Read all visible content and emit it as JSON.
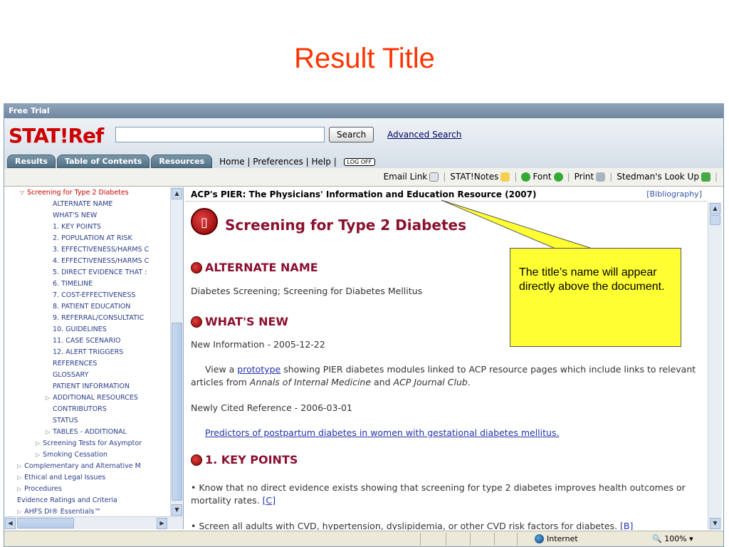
{
  "slide": {
    "title": "Result Title"
  },
  "app": {
    "topbar_text": "Free Trial",
    "logo": "STAT!Ref",
    "search": {
      "value": "",
      "button": "Search",
      "advanced": "Advanced Search"
    },
    "tabs": [
      "Results",
      "Table of Contents",
      "Resources"
    ],
    "toplinks": {
      "home": "Home",
      "preferences": "Preferences",
      "help": "Help",
      "logoff": "LOG OFF"
    },
    "toolbar": {
      "email": "Email Link",
      "notes": "STAT!Notes",
      "font": "Font",
      "print": "Print",
      "stedman": "Stedman's Look Up"
    }
  },
  "sidebar": {
    "items": [
      {
        "label": "Screening for Type 2 Diabetes",
        "arrow": "▽",
        "red": true
      },
      {
        "label": "ALTERNATE NAME"
      },
      {
        "label": "WHAT'S NEW"
      },
      {
        "label": "1. KEY POINTS"
      },
      {
        "label": "2. POPULATION AT RISK"
      },
      {
        "label": "3. EFFECTIVENESS/HARMS C"
      },
      {
        "label": "4. EFFECTIVENESS/HARMS C"
      },
      {
        "label": "5. DIRECT EVIDENCE THAT :"
      },
      {
        "label": "6. TIMELINE"
      },
      {
        "label": "7. COST-EFFECTIVENESS"
      },
      {
        "label": "8. PATIENT EDUCATION"
      },
      {
        "label": "9. REFERRAL/CONSULTATIC"
      },
      {
        "label": "10. GUIDELINES"
      },
      {
        "label": "11. CASE SCENARIO"
      },
      {
        "label": "12. ALERT TRIGGERS"
      },
      {
        "label": "REFERENCES"
      },
      {
        "label": "GLOSSARY"
      },
      {
        "label": "PATIENT INFORMATION"
      },
      {
        "label": "ADDITIONAL RESOURCES",
        "arrow": "▷"
      },
      {
        "label": "CONTRIBUTORS"
      },
      {
        "label": "STATUS"
      },
      {
        "label": "TABLES - ADDITIONAL",
        "arrow": "▷"
      },
      {
        "label": "Screening Tests for Asymptor",
        "arrow": "▷"
      },
      {
        "label": "Smoking Cessation",
        "arrow": "▷"
      },
      {
        "label": "Complementary and Alternative M",
        "arrow": "▷"
      },
      {
        "label": "Ethical and Legal Issues",
        "arrow": "▷"
      },
      {
        "label": "Procedures",
        "arrow": "▷"
      },
      {
        "label": "Evidence Ratings and Criteria"
      },
      {
        "label": "AHFS DI® Essentials™",
        "arrow": "▷"
      }
    ]
  },
  "document": {
    "header": "ACP's PIER: The Physicians' Information and Education Resource (2007)",
    "bibliography": "[Bibliography]",
    "title": "Screening for Type 2 Diabetes",
    "sections": {
      "alt_name_head": "ALTERNATE NAME",
      "alt_name_text": "Diabetes Screening; Screening for Diabetes Mellitus",
      "whats_new_head": "WHAT'S NEW",
      "new_info": "New Information - 2005-12-22",
      "view_a": "View a",
      "prototype": "prototype",
      "view_rest": "showing PIER diabetes modules linked to ACP resource pages which include links to relevant articles from",
      "annals": "Annals of Internal Medicine",
      "and": "and",
      "acp_journal": "ACP Journal Club",
      "period": ".",
      "newly_cited": "Newly Cited Reference - 2006-03-01",
      "predictors": "Predictors of postpartum diabetes in women with gestational diabetes mellitus.",
      "key_points_head": "1. KEY POINTS",
      "kp1": "• Know that no direct evidence exists showing that screening for type 2 diabetes improves health outcomes or mortality rates.",
      "kp1_ref": "[C]",
      "kp2": "• Screen all adults with CVD, hypertension, dyslipidemia, or other CVD risk factors for diabetes.",
      "kp2_ref": "[B]"
    }
  },
  "status": {
    "zone": "Internet",
    "zoom": "100%"
  },
  "callout": {
    "text": "The title’s name will appear directly above the document."
  },
  "colors": {
    "slide_title": "#ff3300",
    "logo": "#cc0000",
    "heading": "#8b1030",
    "callout": "#ffff33"
  }
}
